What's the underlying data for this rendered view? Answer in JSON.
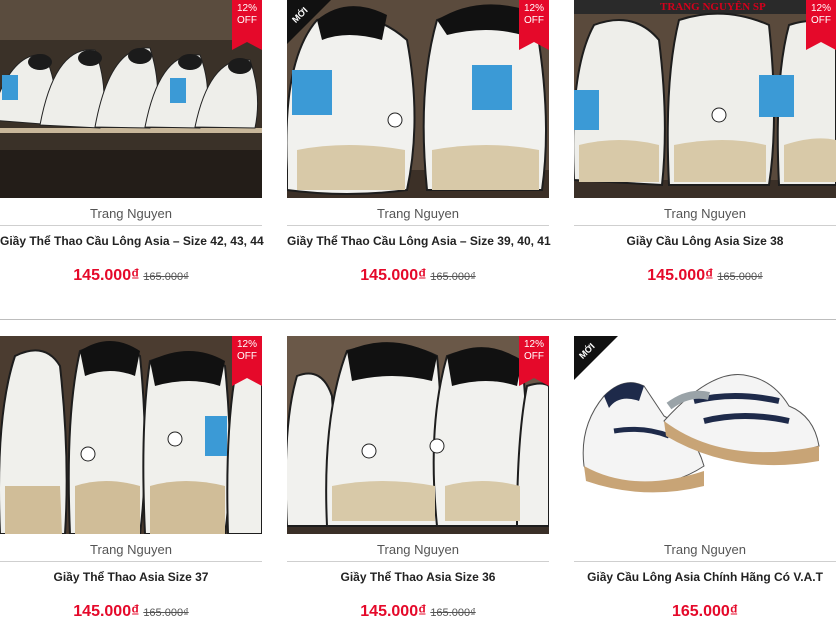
{
  "colors": {
    "sale_red": "#e5092a",
    "badge_black": "#111111"
  },
  "products": [
    {
      "brand": "Trang Nguyen",
      "title": "Giầy Thể Thao Cầu Lông Asia – Size 42, 43, 44",
      "price": "145.000₫",
      "old_price": "165.000₫",
      "sale_badge": [
        "12%",
        "OFF"
      ],
      "new_badge": ""
    },
    {
      "brand": "Trang Nguyen",
      "title": "Giầy Thể Thao Cầu Lông Asia – Size 39, 40, 41",
      "price": "145.000₫",
      "old_price": "165.000₫",
      "sale_badge": [
        "12%",
        "OFF"
      ],
      "new_badge": "MỚI"
    },
    {
      "brand": "Trang Nguyen",
      "title": "Giầy Cầu Lông Asia Size 38",
      "price": "145.000₫",
      "old_price": "165.000₫",
      "sale_badge": [
        "12%",
        "OFF"
      ],
      "new_badge": "",
      "photo_overlay_text": "TRANG NGUYÊN SP"
    },
    {
      "brand": "Trang Nguyen",
      "title": "Giầy Thể Thao Asia Size 37",
      "price": "145.000₫",
      "old_price": "165.000₫",
      "sale_badge": [
        "12%",
        "OFF"
      ],
      "new_badge": ""
    },
    {
      "brand": "Trang Nguyen",
      "title": "Giầy Thể Thao Asia Size 36",
      "price": "145.000₫",
      "old_price": "165.000₫",
      "sale_badge": [
        "12%",
        "OFF"
      ],
      "new_badge": ""
    },
    {
      "brand": "Trang Nguyen",
      "title": "Giầy Cầu Lông Asia Chính Hãng Có V.A.T",
      "price": "165.000₫",
      "old_price": "",
      "sale_badge": null,
      "new_badge": "MỚI"
    }
  ]
}
